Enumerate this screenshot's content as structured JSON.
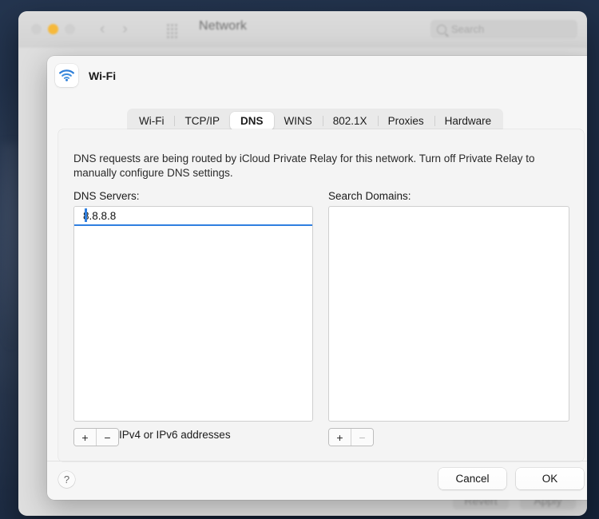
{
  "window": {
    "title": "Network",
    "traffic_lights": [
      "close",
      "minimize",
      "maximize"
    ],
    "nav": {
      "back": "‹",
      "forward": "›"
    },
    "grid_icon": "grid-icon",
    "search": {
      "placeholder": "Search",
      "value": ""
    },
    "background_buttons": {
      "revert": "Revert",
      "apply": "Apply"
    }
  },
  "sheet": {
    "service_name": "Wi-Fi",
    "service_icon": "wifi-icon",
    "tabs": [
      {
        "label": "Wi-Fi",
        "active": false
      },
      {
        "label": "TCP/IP",
        "active": false
      },
      {
        "label": "DNS",
        "active": true
      },
      {
        "label": "WINS",
        "active": false
      },
      {
        "label": "802.1X",
        "active": false
      },
      {
        "label": "Proxies",
        "active": false
      },
      {
        "label": "Hardware",
        "active": false
      }
    ],
    "notice": "DNS requests are being routed by iCloud Private Relay for this network. Turn off Private Relay to manually configure DNS settings.",
    "dns": {
      "label": "DNS Servers:",
      "entries": [
        "8.8.8.8"
      ],
      "hint": "IPv4 or IPv6 addresses",
      "add_label": "+",
      "remove_label": "−"
    },
    "search_domains": {
      "label": "Search Domains:",
      "entries": [],
      "add_label": "+",
      "remove_label": "−"
    },
    "footer": {
      "help_label": "?",
      "cancel_label": "Cancel",
      "ok_label": "OK"
    }
  },
  "colors": {
    "accent": "#2f7fe0",
    "sheet_bg": "#f6f6f6",
    "panel_bg": "#f4f4f4",
    "amber_light": "#f6b93b",
    "desktop": "#1d2c45"
  }
}
